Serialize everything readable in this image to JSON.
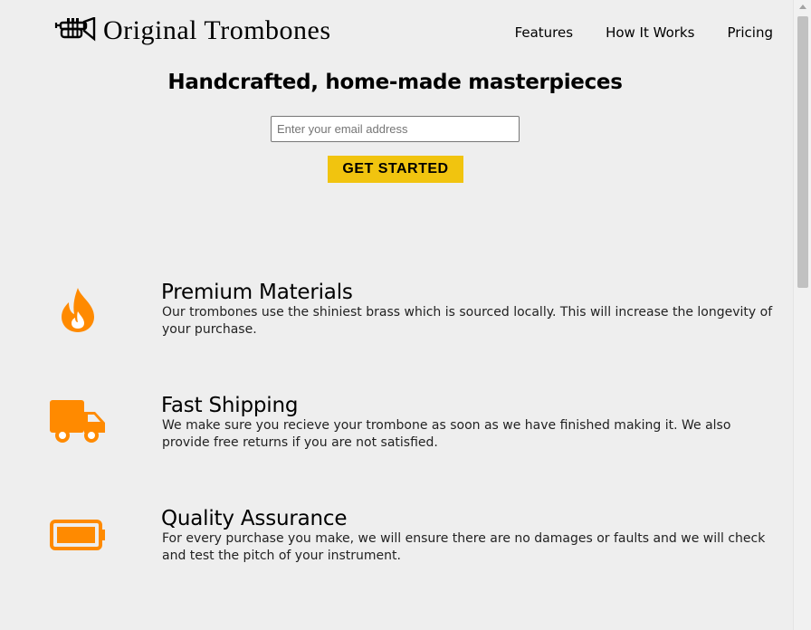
{
  "brand": {
    "name": "Original Trombones",
    "logo_icon": "trumpet-icon"
  },
  "nav": {
    "items": [
      "Features",
      "How It Works",
      "Pricing"
    ]
  },
  "hero": {
    "title": "Handcrafted, home-made masterpieces",
    "email_placeholder": "Enter your email address",
    "email_value": "",
    "cta_label": "GET STARTED"
  },
  "features": [
    {
      "icon": "flame-icon",
      "title": "Premium Materials",
      "text": "Our trombones use the shiniest brass which is sourced locally. This will increase the longevity of your purchase."
    },
    {
      "icon": "truck-icon",
      "title": "Fast Shipping",
      "text": "We make sure you recieve your trombone as soon as we have finished making it. We also provide free returns if you are not satisfied."
    },
    {
      "icon": "battery-icon",
      "title": "Quality Assurance",
      "text": "For every purchase you make, we will ensure there are no damages or faults and we will check and test the pitch of your instrument."
    }
  ],
  "colors": {
    "accent": "#f1c40f",
    "icon_orange": "#ff8a00",
    "background": "#eeeeee"
  }
}
